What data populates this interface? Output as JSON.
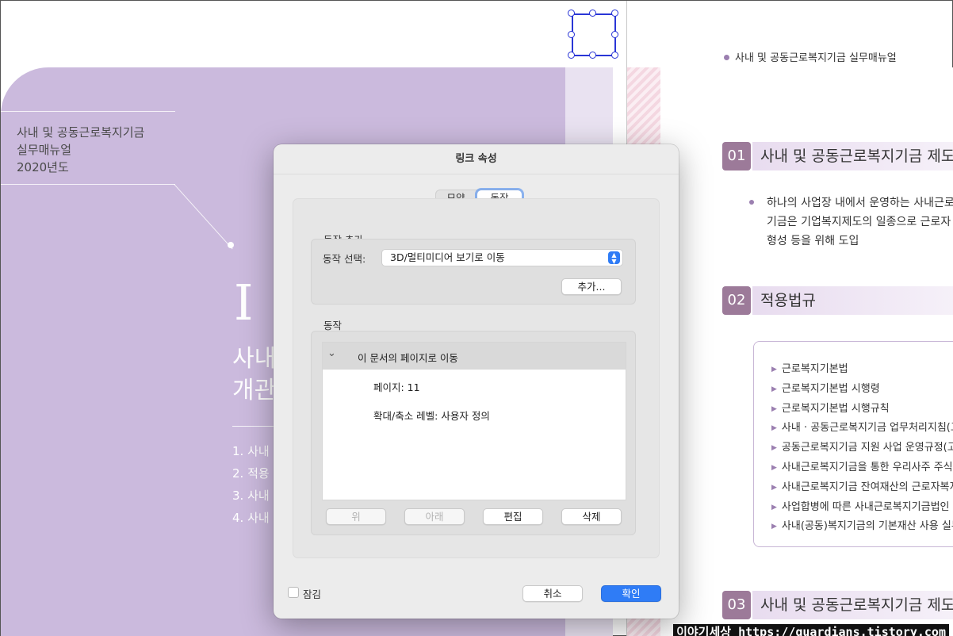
{
  "left_page": {
    "subtitle_lines": [
      "사내 및 공동근로복지기금",
      "실무매뉴얼",
      "2020년도"
    ],
    "roman_numeral": "I",
    "title_lines": [
      "사내",
      "개관"
    ],
    "toc": [
      "1. 사내",
      "2. 적용",
      "3. 사내",
      "4. 사내"
    ]
  },
  "right_page": {
    "running_head": "사내 및 공동근로복지기금 실무매뉴얼",
    "sections": [
      {
        "num": "01",
        "title": "사내 및 공동근로복지기금 제도"
      },
      {
        "num": "02",
        "title": "적용법규"
      },
      {
        "num": "03",
        "title": "사내 및 공동근로복지기금 제도"
      }
    ],
    "paragraph_lines": [
      "하나의 사업장 내에서 운영하는 사내근로",
      "기금은 기업복지제도의 일종으로 근로자",
      "형성 등을 위해 도입"
    ],
    "laws": [
      "근로복지기본법",
      "근로복지기본법 시행령",
      "근로복지기본법 시행규칙",
      "사내 · 공동근로복지기금 업무처리지침(고",
      "공동근로복지기금 지원 사업 운영규정(고",
      "사내근로복지기금을 통한 우리사주 주식",
      "사내근로복지기금 잔여재산의 근로자복지",
      "사업합병에 따른 사내근로복지기금법인",
      "사내(공동)복지기금의 기본재산 사용 실무"
    ]
  },
  "watermark": "이야기세상 https://guardians.tistory.com",
  "dialog": {
    "title": "링크 속성",
    "tabs": [
      {
        "label": "모양",
        "selected": false
      },
      {
        "label": "동작",
        "selected": true
      }
    ],
    "add_action_group": "동작 추가",
    "select_label": "동작 선택:",
    "select_value": "3D/멀티미디어 보기로 이동",
    "add_button": "추가...",
    "actions_group": "동작",
    "action_item": {
      "label": "이 문서의 페이지로 이동",
      "expanded": true,
      "details": [
        "페이지: 11",
        "확대/축소 레벨: 사용자 정의"
      ]
    },
    "buttons": {
      "up": "위",
      "down": "아래",
      "edit": "편집",
      "delete": "삭제",
      "cancel": "취소",
      "ok": "확인"
    },
    "lock_label": "잠김",
    "lock_checked": false
  },
  "colors": {
    "accent": "#2f7cf6",
    "cover_purple": "#cbbadd",
    "section_badge": "#9c7a99",
    "selection_blue": "#2a36d6"
  }
}
